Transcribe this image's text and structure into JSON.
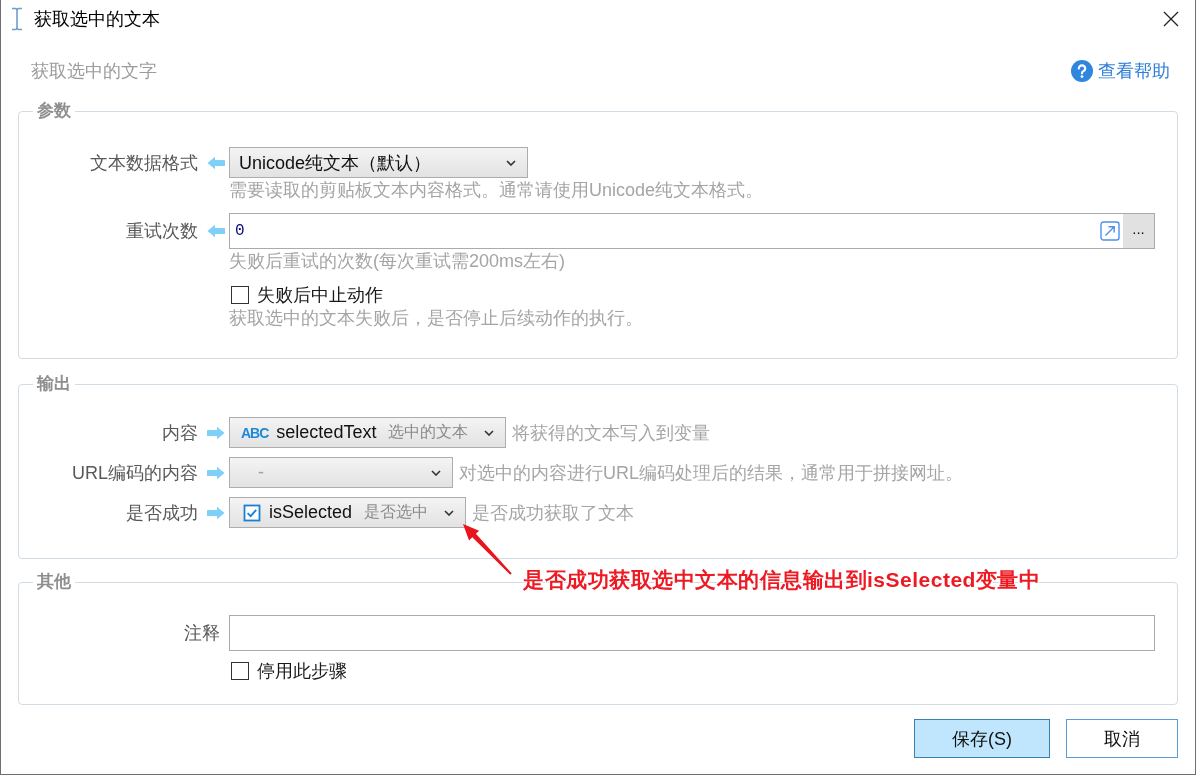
{
  "window": {
    "title": "获取选中的文本"
  },
  "subtitle": "获取选中的文字",
  "help": {
    "label": "查看帮助"
  },
  "groups": [
    {
      "title": "参数",
      "rows": [
        {
          "kind": "select",
          "label": "文本数据格式",
          "arrow": {
            "kind": "in"
          },
          "value": "Unicode纯文本（默认）",
          "hint": "需要读取的剪贴板文本内容格式。通常请使用Unicode纯文本格式。"
        },
        {
          "kind": "text",
          "label": "重试次数",
          "arrow": {
            "kind": "in"
          },
          "value": "0",
          "more_button": "...",
          "hint": "失败后重试的次数(每次重试需200ms左右)"
        },
        {
          "kind": "checkbox",
          "label": "失败后中止动作",
          "checked": false,
          "hint": "获取选中的文本失败后，是否停止后续动作的执行。"
        }
      ]
    },
    {
      "title": "输出",
      "rows": [
        {
          "kind": "variable",
          "label": "内容",
          "arrow": {
            "kind": "out"
          },
          "type_icon": {
            "kind": "text",
            "label": "ABC"
          },
          "value": "selectedText",
          "caption": "选中的文本",
          "note": "将获得的文本写入到变量"
        },
        {
          "kind": "variable",
          "label": "URL编码的内容",
          "arrow": {
            "kind": "out"
          },
          "placeholder": "-",
          "note": "对选中的内容进行URL编码处理后的结果，通常用于拼接网址。"
        },
        {
          "kind": "variable",
          "label": "是否成功",
          "arrow": {
            "kind": "out"
          },
          "type_icon": {
            "kind": "boolean"
          },
          "value": "isSelected",
          "caption": "是否选中",
          "note": "是否成功获取了文本"
        }
      ]
    },
    {
      "title": "其他",
      "rows": [
        {
          "kind": "text",
          "label": "注释"
        },
        {
          "kind": "checkbox",
          "label": "停用此步骤",
          "checked": false
        }
      ]
    }
  ],
  "annotation": {
    "text": "是否成功获取选中文本的信息输出到isSelected变量中"
  },
  "buttons": [
    {
      "label": "保存(S)",
      "primary": true
    },
    {
      "label": "取消",
      "primary": false
    }
  ]
}
